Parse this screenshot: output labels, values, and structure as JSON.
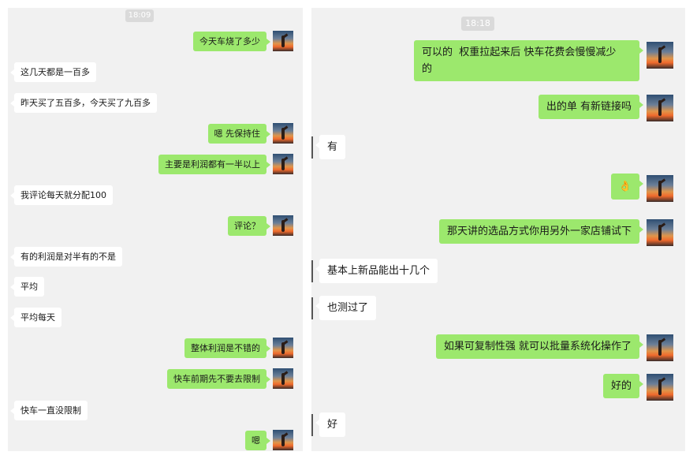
{
  "left_chat": {
    "timestamp": "18:09",
    "messages": [
      {
        "text": "今天车烧了多少",
        "dir": "out"
      },
      {
        "text": "这几天都是一百多",
        "dir": "in"
      },
      {
        "text": "昨天买了五百多，今天买了九百多",
        "dir": "in"
      },
      {
        "text": "嗯 先保持住",
        "dir": "out"
      },
      {
        "text": "主要是利润都有一半以上",
        "dir": "out"
      },
      {
        "text": "我评论每天就分配100",
        "dir": "in"
      },
      {
        "text": "评论？",
        "dir": "out"
      },
      {
        "text": "有的利润是对半有的不是",
        "dir": "in"
      },
      {
        "text": "平均",
        "dir": "in"
      },
      {
        "text": "平均每天",
        "dir": "in"
      },
      {
        "text": "整体利润是不错的",
        "dir": "out"
      },
      {
        "text": "快车前期先不要去限制",
        "dir": "out"
      },
      {
        "text": "快车一直没限制",
        "dir": "in"
      },
      {
        "text": "嗯",
        "dir": "out"
      }
    ]
  },
  "right_chat": {
    "timestamp": "18:18",
    "messages": [
      {
        "text": "可以的  权重拉起来后 快车花费会慢慢减少\n的",
        "dir": "out"
      },
      {
        "text": "出的单 有新链接吗",
        "dir": "out"
      },
      {
        "text": "有",
        "dir": "in"
      },
      {
        "text": "👌",
        "dir": "out",
        "icon": "ok-hand-emoji"
      },
      {
        "text": "那天讲的选品方式你用另外一家店铺试下",
        "dir": "out"
      },
      {
        "text": "基本上新品能出十几个",
        "dir": "in"
      },
      {
        "text": "也测过了",
        "dir": "in"
      },
      {
        "text": "如果可复制性强 就可以批量系统化操作了",
        "dir": "out"
      },
      {
        "text": "好的",
        "dir": "out"
      },
      {
        "text": "好",
        "dir": "in"
      }
    ]
  }
}
